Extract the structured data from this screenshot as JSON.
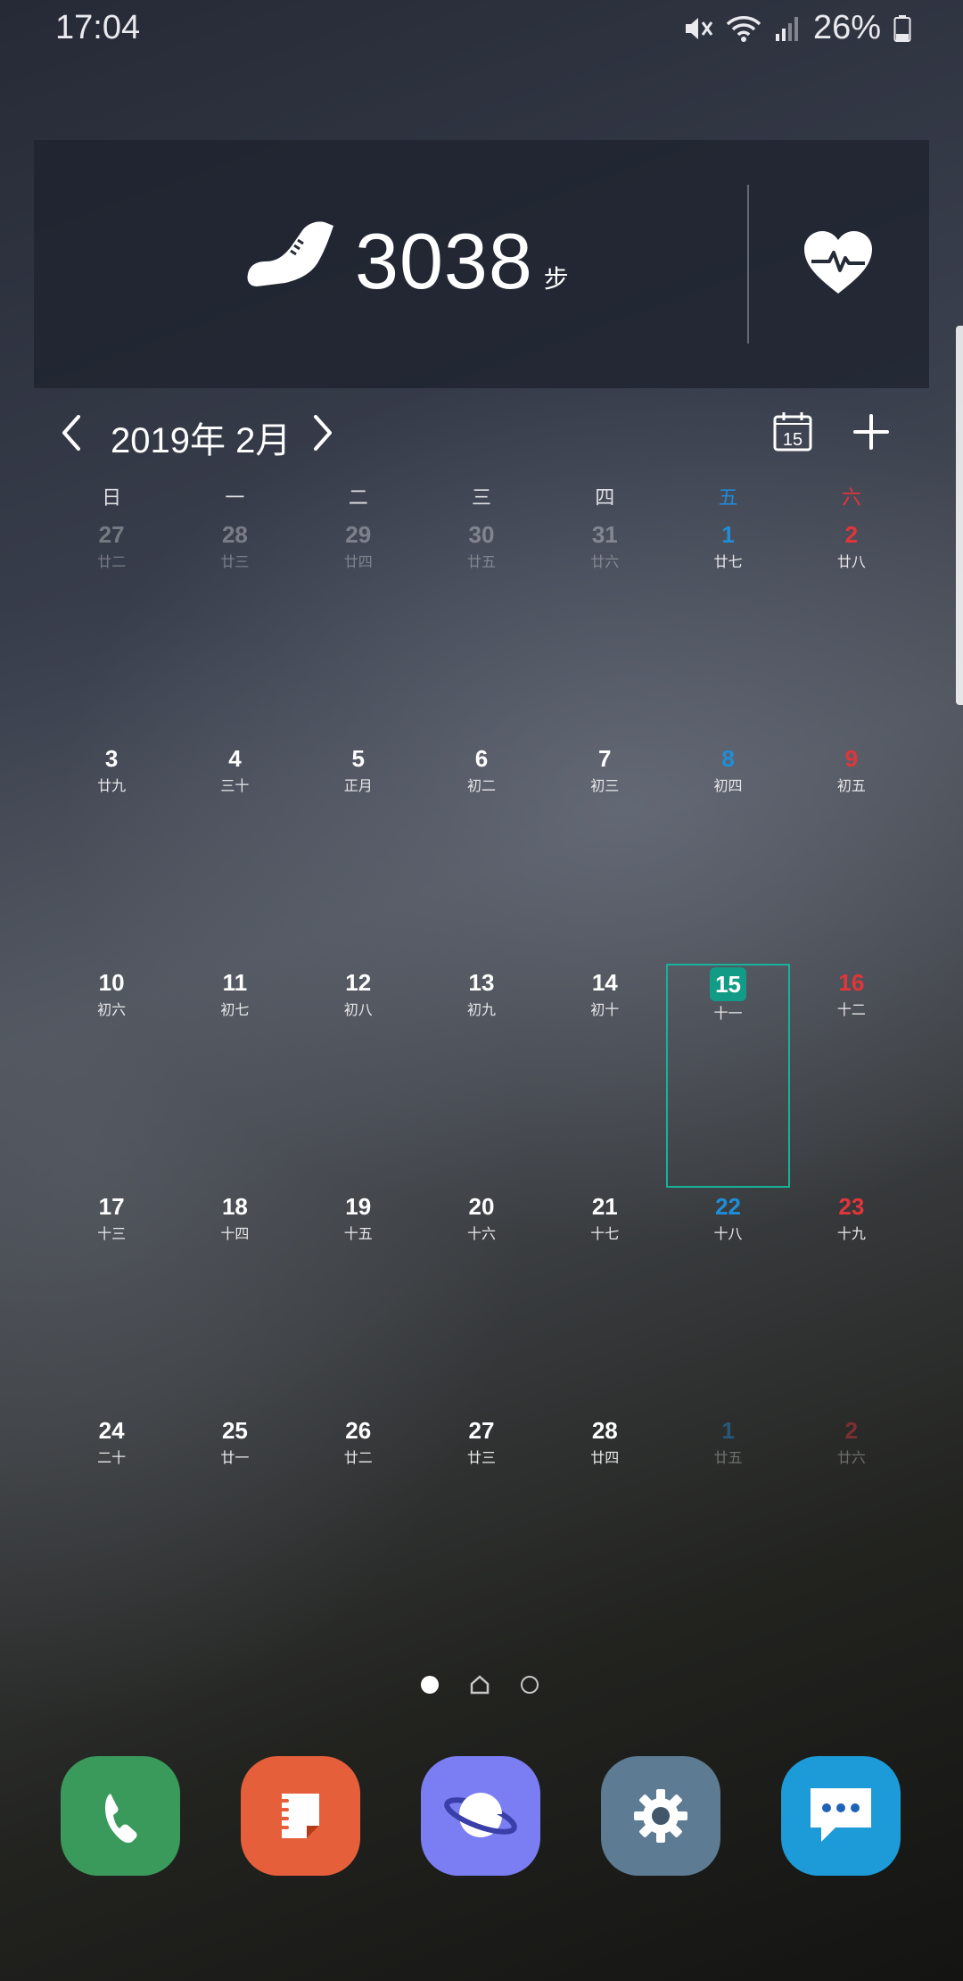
{
  "status_bar": {
    "time": "17:04",
    "battery": "26%",
    "icons": [
      "mute-icon",
      "wifi-icon",
      "signal-icon",
      "battery-icon"
    ]
  },
  "health_widget": {
    "steps": "3038",
    "steps_unit": "步",
    "icons": [
      "shoe-icon",
      "heart-rate-icon"
    ]
  },
  "calendar": {
    "month_title": "2019年 2月",
    "weekdays": [
      "日",
      "一",
      "二",
      "三",
      "四",
      "五",
      "六"
    ],
    "days": [
      {
        "num": "27",
        "lunar": "廿二",
        "other": true
      },
      {
        "num": "28",
        "lunar": "廿三",
        "other": true
      },
      {
        "num": "29",
        "lunar": "廿四",
        "other": true
      },
      {
        "num": "30",
        "lunar": "廿五",
        "other": true
      },
      {
        "num": "31",
        "lunar": "廿六",
        "other": true
      },
      {
        "num": "1",
        "lunar": "廿七"
      },
      {
        "num": "2",
        "lunar": "廿八"
      },
      {
        "num": "3",
        "lunar": "廿九"
      },
      {
        "num": "4",
        "lunar": "三十"
      },
      {
        "num": "5",
        "lunar": "正月"
      },
      {
        "num": "6",
        "lunar": "初二"
      },
      {
        "num": "7",
        "lunar": "初三"
      },
      {
        "num": "8",
        "lunar": "初四"
      },
      {
        "num": "9",
        "lunar": "初五"
      },
      {
        "num": "10",
        "lunar": "初六"
      },
      {
        "num": "11",
        "lunar": "初七"
      },
      {
        "num": "12",
        "lunar": "初八"
      },
      {
        "num": "13",
        "lunar": "初九"
      },
      {
        "num": "14",
        "lunar": "初十"
      },
      {
        "num": "15",
        "lunar": "十一",
        "today": true
      },
      {
        "num": "16",
        "lunar": "十二"
      },
      {
        "num": "17",
        "lunar": "十三"
      },
      {
        "num": "18",
        "lunar": "十四"
      },
      {
        "num": "19",
        "lunar": "十五"
      },
      {
        "num": "20",
        "lunar": "十六"
      },
      {
        "num": "21",
        "lunar": "十七"
      },
      {
        "num": "22",
        "lunar": "十八"
      },
      {
        "num": "23",
        "lunar": "十九"
      },
      {
        "num": "24",
        "lunar": "二十"
      },
      {
        "num": "25",
        "lunar": "廿一"
      },
      {
        "num": "26",
        "lunar": "廿二"
      },
      {
        "num": "27",
        "lunar": "廿三"
      },
      {
        "num": "28",
        "lunar": "廿四"
      },
      {
        "num": "1",
        "lunar": "廿五",
        "other": true
      },
      {
        "num": "2",
        "lunar": "廿六",
        "other": true
      }
    ],
    "today_icon_label": "15",
    "colors": {
      "friday": "#1f8ed8",
      "saturday": "#e2353a",
      "today": "#129b86"
    }
  },
  "pager": {
    "pages": 3,
    "current": 1
  },
  "dock": {
    "apps": [
      {
        "name": "phone",
        "icon": "phone-icon",
        "color": "#3a9a5b"
      },
      {
        "name": "notes",
        "icon": "notes-icon",
        "color": "#e5603a"
      },
      {
        "name": "browser",
        "icon": "planet-icon",
        "color": "#7b7ef2"
      },
      {
        "name": "settings",
        "icon": "gear-icon",
        "color": "#5d7b92"
      },
      {
        "name": "messages",
        "icon": "message-icon",
        "color": "#1d9ad8"
      }
    ]
  }
}
